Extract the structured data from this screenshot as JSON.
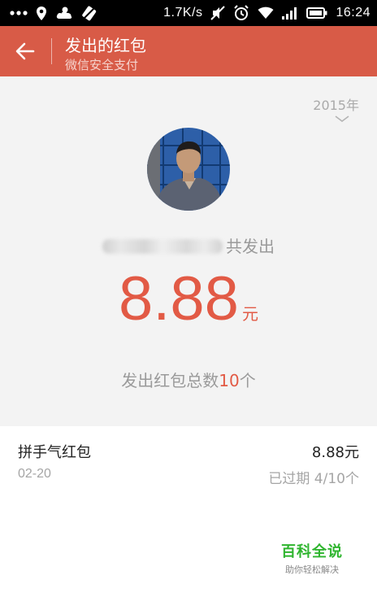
{
  "status_bar": {
    "left_icons": [
      "more-dots-icon",
      "location-pin-icon",
      "weather-cloud-icon",
      "no-sim-icon"
    ],
    "net_speed": "1.7K/s",
    "right_icons": [
      "mute-icon",
      "alarm-icon",
      "wifi-icon",
      "signal-icon",
      "battery-icon"
    ],
    "time": "16:24"
  },
  "header": {
    "title": "发出的红包",
    "subtitle": "微信安全支付",
    "bg_color": "#d85b47"
  },
  "summary": {
    "year": "2015年",
    "sender_suffix": "共发出",
    "amount": "8.88",
    "amount_unit": "元",
    "count_prefix": "发出红包总数",
    "count_value": "10",
    "count_suffix": "个",
    "accent_color": "#e25a45"
  },
  "list": {
    "items": [
      {
        "title": "拼手气红包",
        "date": "02-20",
        "amount": "8.88元",
        "status": "已过期 4/10个"
      }
    ]
  },
  "watermark": {
    "main": "百科全说",
    "sub": "助你轻松解决"
  }
}
